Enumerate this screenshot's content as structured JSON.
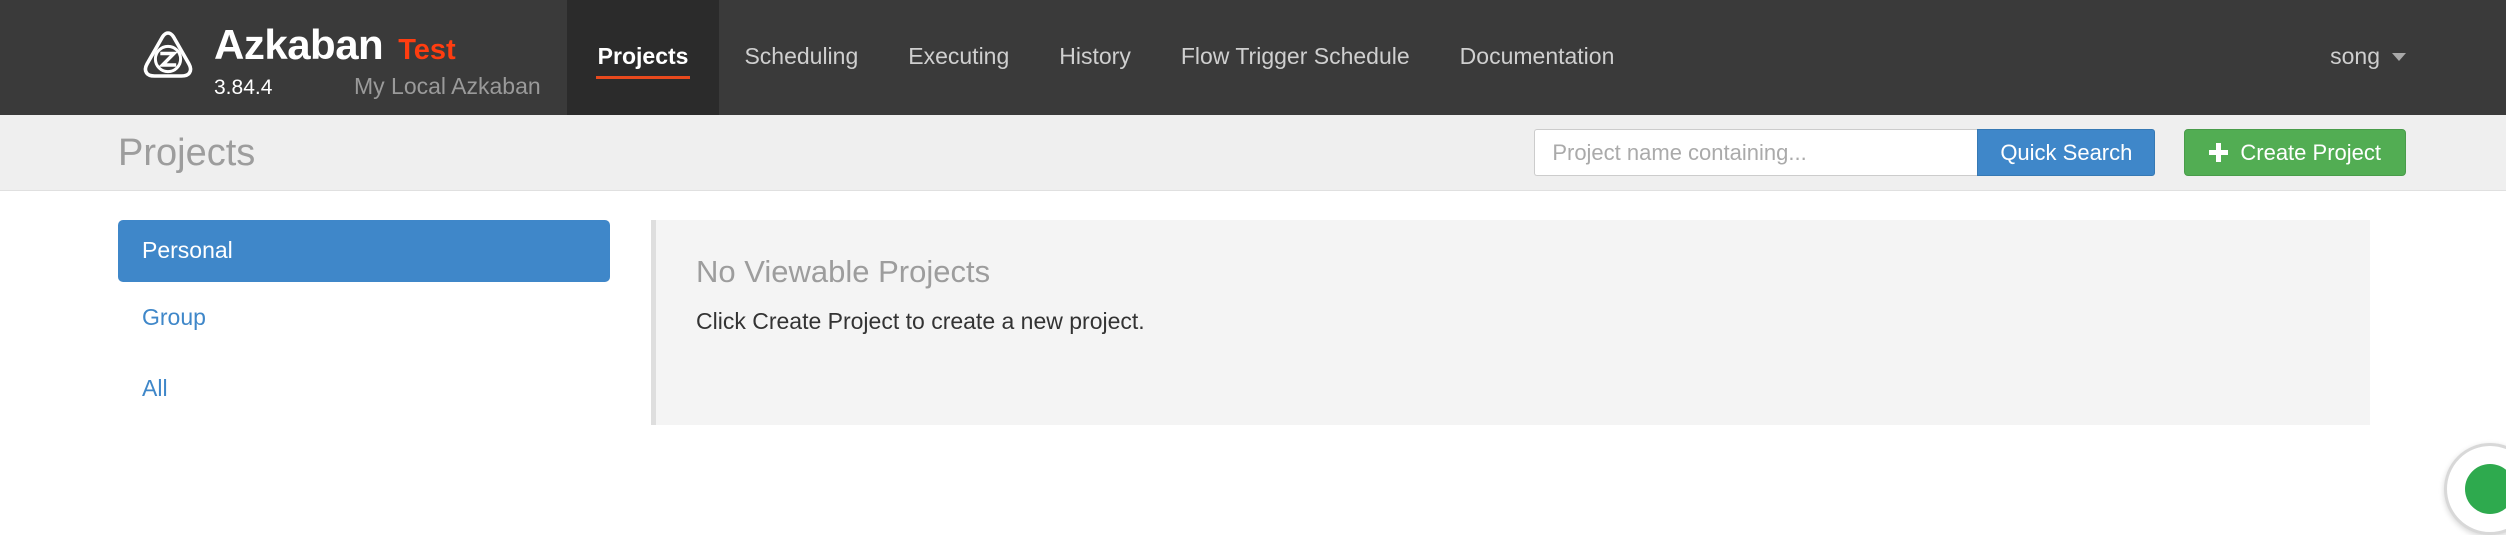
{
  "navbar": {
    "logo_icon": "azkaban-triangle-z-logo",
    "brand_name": "Azkaban",
    "brand_suffix": "Test",
    "version": "3.84.4",
    "tagline": "My Local Azkaban",
    "links": [
      {
        "label": "Projects",
        "active": true
      },
      {
        "label": "Scheduling",
        "active": false
      },
      {
        "label": "Executing",
        "active": false
      },
      {
        "label": "History",
        "active": false
      },
      {
        "label": "Flow Trigger Schedule",
        "active": false
      },
      {
        "label": "Documentation",
        "active": false
      }
    ],
    "user": {
      "name": "song",
      "caret_icon": "chevron-down-icon"
    }
  },
  "subheader": {
    "title": "Projects",
    "search": {
      "value": "",
      "placeholder": "Project name containing...",
      "button_label": "Quick Search"
    },
    "create_button": {
      "label": "Create Project",
      "icon": "plus-icon"
    }
  },
  "sidebar": {
    "items": [
      {
        "label": "Personal",
        "active": true
      },
      {
        "label": "Group",
        "active": false
      },
      {
        "label": "All",
        "active": false
      }
    ]
  },
  "main": {
    "empty_state_title": "No Viewable Projects",
    "empty_state_text": "Click Create Project to create a new project."
  },
  "corner_badge": {
    "icon": "green-status-circle-icon"
  },
  "colors": {
    "navbar_bg": "#3a3a3a",
    "navbar_active_bg": "#2b2b2b",
    "accent_orange": "#e8491d",
    "brand_suffix_color": "#ff3d10",
    "subheader_bg": "#efefef",
    "primary_blue": "#3f87c9",
    "success_green": "#52ad53",
    "panel_bg": "#f4f4f4",
    "badge_green": "#2eaa4e"
  }
}
